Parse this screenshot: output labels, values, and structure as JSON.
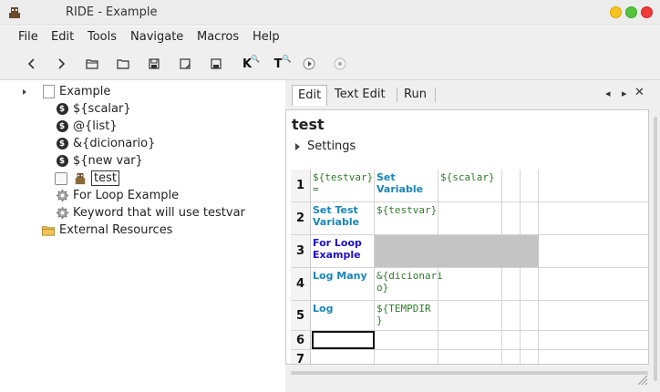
{
  "window": {
    "title": "RIDE - Example"
  },
  "menu": [
    "File",
    "Edit",
    "Tools",
    "Navigate",
    "Macros",
    "Help"
  ],
  "tree": {
    "root": "Example",
    "variables": [
      "${scalar}",
      "@{list}",
      "&{dicionario}",
      "${new var}"
    ],
    "test_case": "test",
    "keywords": [
      "For Loop Example",
      "Keyword that will use testvar"
    ],
    "external": "External Resources"
  },
  "tabs": {
    "edit": "Edit",
    "text_edit": "Text Edit",
    "run": "Run"
  },
  "editor": {
    "heading": "test",
    "settings_label": "Settings",
    "rows": [
      {
        "num": "1",
        "c1": "${testvar}\n=",
        "c2": "Set\nVariable",
        "c3": "${scalar}"
      },
      {
        "num": "2",
        "c1": "Set Test\nVariable",
        "c2": "${testvar}",
        "c3": ""
      },
      {
        "num": "3",
        "c1": "For Loop\nExample",
        "c2": "",
        "c3": ""
      },
      {
        "num": "4",
        "c1": "Log Many",
        "c2": "&{dicionari\no}",
        "c3": ""
      },
      {
        "num": "5",
        "c1": "Log",
        "c2": "${TEMPDIR\n}",
        "c3": ""
      },
      {
        "num": "6",
        "c1": "",
        "c2": "",
        "c3": ""
      },
      {
        "num": "7",
        "c1": "",
        "c2": "",
        "c3": ""
      }
    ]
  },
  "colors": {
    "keyword": "#1a86b5",
    "keyword_user": "#1e10c8",
    "variable": "#2f7b2b",
    "grey_cell": "#c4c4c4"
  }
}
